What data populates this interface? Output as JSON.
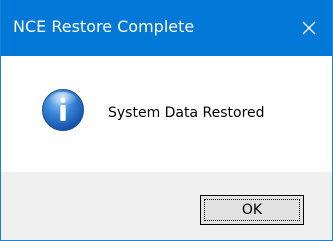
{
  "window": {
    "title": "NCE Restore Complete",
    "close_icon": "close-icon",
    "titlebar_color": "#0078d7"
  },
  "content": {
    "icon": "info-icon",
    "message": "System Data Restored"
  },
  "footer": {
    "ok_label": "OK"
  }
}
